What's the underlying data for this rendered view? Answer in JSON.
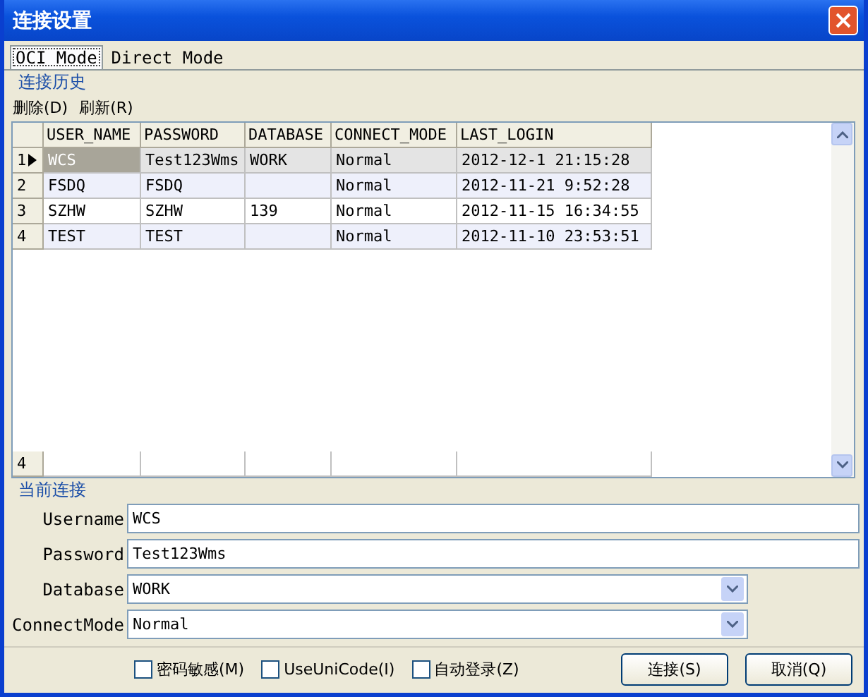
{
  "window": {
    "title": "连接设置"
  },
  "tabs": [
    {
      "label": "OCI Mode",
      "selected": true
    },
    {
      "label": "Direct Mode",
      "selected": false
    }
  ],
  "history": {
    "title": "连接历史",
    "toolbar": [
      "删除(D)",
      "刷新(R)"
    ],
    "columns": [
      "USER_NAME",
      "PASSWORD",
      "DATABASE",
      "CONNECT_MODE",
      "LAST_LOGIN"
    ],
    "rows": [
      {
        "number": "1",
        "selected": true,
        "cells": [
          "WCS",
          "Test123Wms",
          "WORK",
          "Normal",
          "2012-12-1 21:15:28"
        ]
      },
      {
        "number": "2",
        "selected": false,
        "cells": [
          "FSDQ",
          "FSDQ",
          "",
          "Normal",
          "2012-11-21 9:52:28"
        ]
      },
      {
        "number": "3",
        "selected": false,
        "cells": [
          "SZHW",
          "SZHW",
          "139",
          "Normal",
          "2012-11-15 16:34:55"
        ]
      },
      {
        "number": "4",
        "selected": false,
        "cells": [
          "TEST",
          "TEST",
          "",
          "Normal",
          "2012-11-10 23:53:51"
        ]
      }
    ],
    "footer_count": "4"
  },
  "current": {
    "title": "当前连接",
    "fields": [
      {
        "label": "Username",
        "value": "WCS",
        "kind": "text"
      },
      {
        "label": "Password",
        "value": "Test123Wms",
        "kind": "text"
      },
      {
        "label": "Database",
        "value": "WORK",
        "kind": "combo"
      },
      {
        "label": "ConnectMode",
        "value": "Normal",
        "kind": "combo"
      }
    ]
  },
  "options": [
    {
      "label": "密码敏感(M)",
      "checked": false
    },
    {
      "label": "UseUniCode(I)",
      "checked": false
    },
    {
      "label": "自动登录(Z)",
      "checked": false
    }
  ],
  "buttons": [
    "连接(S)",
    "取消(Q)"
  ]
}
